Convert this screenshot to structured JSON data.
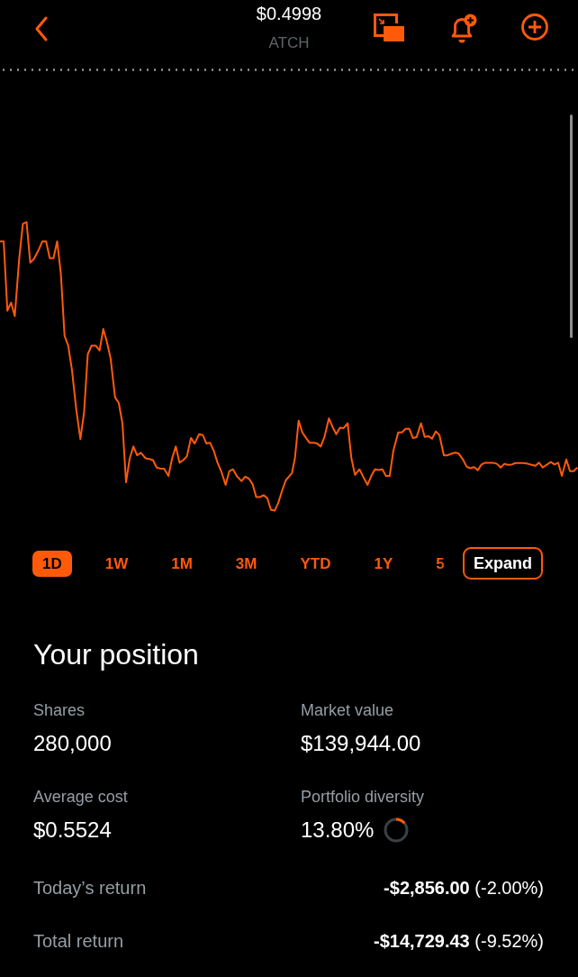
{
  "header": {
    "price": "$0.4998",
    "ticker": "ATCH"
  },
  "ranges": [
    {
      "label": "1D",
      "selected": true
    },
    {
      "label": "1W",
      "selected": false
    },
    {
      "label": "1M",
      "selected": false
    },
    {
      "label": "3M",
      "selected": false
    },
    {
      "label": "YTD",
      "selected": false
    },
    {
      "label": "1Y",
      "selected": false
    },
    {
      "label": "5",
      "selected": false
    }
  ],
  "expand_button": {
    "label": "Expand"
  },
  "position": {
    "title": "Your position",
    "stats": [
      {
        "label": "Shares",
        "value": "280,000"
      },
      {
        "label": "Market value",
        "value": "$139,944.00"
      },
      {
        "label": "Average cost",
        "value": "$0.5524"
      },
      {
        "label": "Portfolio diversity",
        "value": "13.80%",
        "level": 0.138
      }
    ],
    "returns": [
      {
        "label": "Today’s return",
        "value": "**-$2,856.00** (-2.00%)"
      },
      {
        "label": "Total return",
        "value": "**-$14,729.43** (-9.52%)"
      }
    ]
  }
}
